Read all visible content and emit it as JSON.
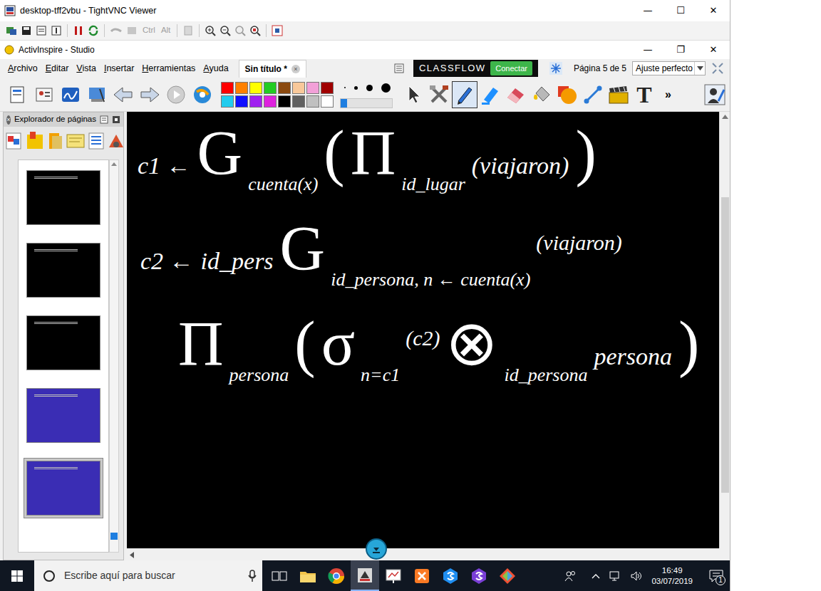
{
  "vnc": {
    "title": "desktop-tff2vbu - TightVNC Viewer",
    "controls": [
      "—",
      "☐",
      "✕"
    ],
    "keys": [
      {
        "label": "Ctrl",
        "disabled": true
      },
      {
        "label": "Alt",
        "disabled": true
      }
    ]
  },
  "app": {
    "title": "ActivInspire - Studio",
    "controls": [
      "—",
      "❐",
      "✕"
    ],
    "menu": [
      "Archivo",
      "Editar",
      "Vista",
      "Insertar",
      "Herramientas",
      "Ayuda"
    ],
    "doc_tab": {
      "label": "Sin título *",
      "close": "×"
    },
    "classflow": {
      "brand": "CLASSFLOW",
      "button": "Conectar"
    },
    "page_indicator": "Página 5 de 5",
    "zoom": "Ajuste perfecto",
    "more": "»"
  },
  "palette": [
    {
      "color": "#ff0000"
    },
    {
      "color": "#ff8000"
    },
    {
      "color": "#ffff00"
    },
    {
      "color": "#22cc22"
    },
    {
      "color": "#8b4a10"
    },
    {
      "color": "#f8c89a"
    },
    {
      "color": "#f2a0d8"
    },
    {
      "color": "#a00000"
    },
    {
      "color": "#22ccee"
    },
    {
      "color": "#1010ff"
    },
    {
      "color": "#a020f0"
    },
    {
      "color": "#dd22dd"
    },
    {
      "color": "#000000"
    },
    {
      "color": "#606060"
    },
    {
      "color": "#c0c0c0"
    },
    {
      "color": "#ffffff"
    }
  ],
  "pen": {
    "level": 0.12
  },
  "tools": [
    {
      "kind": "pointer",
      "selected": false
    },
    {
      "kind": "tools",
      "selected": false
    },
    {
      "kind": "pen",
      "selected": true
    },
    {
      "kind": "highlighter",
      "selected": false
    },
    {
      "kind": "eraser",
      "selected": false
    },
    {
      "kind": "fill",
      "selected": false
    },
    {
      "kind": "shape",
      "selected": false
    },
    {
      "kind": "connector",
      "selected": false
    },
    {
      "kind": "clapper",
      "selected": false
    },
    {
      "kind": "text",
      "selected": false,
      "label": "T"
    }
  ],
  "explorer": {
    "title": "Explorador de páginas",
    "close": "×",
    "pages": [
      {
        "kind": "black",
        "selected": false
      },
      {
        "kind": "black",
        "selected": false
      },
      {
        "kind": "black",
        "selected": false
      },
      {
        "kind": "blue",
        "selected": false
      },
      {
        "kind": "blue",
        "selected": true
      }
    ]
  },
  "canvas": {
    "formulas": [
      {
        "tokens": [
          {
            "text": "c1 ←",
            "kind": "base"
          },
          {
            "text": "G",
            "kind": "big"
          },
          {
            "text": "cuenta(x)",
            "kind": "sub"
          },
          {
            "text": "(",
            "kind": "big"
          },
          {
            "text": "Π",
            "kind": "big"
          },
          {
            "text": "id_lugar",
            "kind": "sub"
          },
          {
            "text": "(viajaron)",
            "kind": "base"
          },
          {
            "text": ")",
            "kind": "big"
          }
        ]
      },
      {
        "tokens": [
          {
            "text": "c2 ←",
            "kind": "base"
          },
          {
            "text": "id_pers",
            "kind": "base"
          },
          {
            "text": "G",
            "kind": "big"
          },
          {
            "text": "id_persona, n ← cuenta(x)",
            "kind": "sub"
          },
          {
            "text": "(viajaron)",
            "kind": "sup"
          }
        ]
      },
      {
        "tokens": [
          {
            "text": "Π",
            "kind": "big"
          },
          {
            "text": "persona",
            "kind": "sub"
          },
          {
            "text": "(",
            "kind": "big"
          },
          {
            "text": "σ",
            "kind": "big"
          },
          {
            "text": "n=c1",
            "kind": "sub"
          },
          {
            "text": "(c2)",
            "kind": "sup"
          },
          {
            "text": "⊗",
            "kind": "big"
          },
          {
            "text": "id_persona",
            "kind": "sub"
          },
          {
            "text": "persona",
            "kind": "base"
          },
          {
            "text": ")",
            "kind": "big"
          }
        ]
      }
    ]
  },
  "trash": {
    "close": "×"
  },
  "taskbar": {
    "search": "Escribe aquí para buscar",
    "apps": [
      {
        "kind": "taskview",
        "active": false
      },
      {
        "kind": "explorer",
        "active": false
      },
      {
        "kind": "chrome",
        "active": false
      },
      {
        "kind": "vnc",
        "active": true
      },
      {
        "kind": "board",
        "active": false
      },
      {
        "kind": "xampp",
        "active": false
      },
      {
        "kind": "blue-app",
        "active": false
      },
      {
        "kind": "purple-app",
        "active": false
      },
      {
        "kind": "git",
        "active": false
      }
    ],
    "time": "16:49",
    "date": "03/07/2019",
    "notifications": "1"
  }
}
